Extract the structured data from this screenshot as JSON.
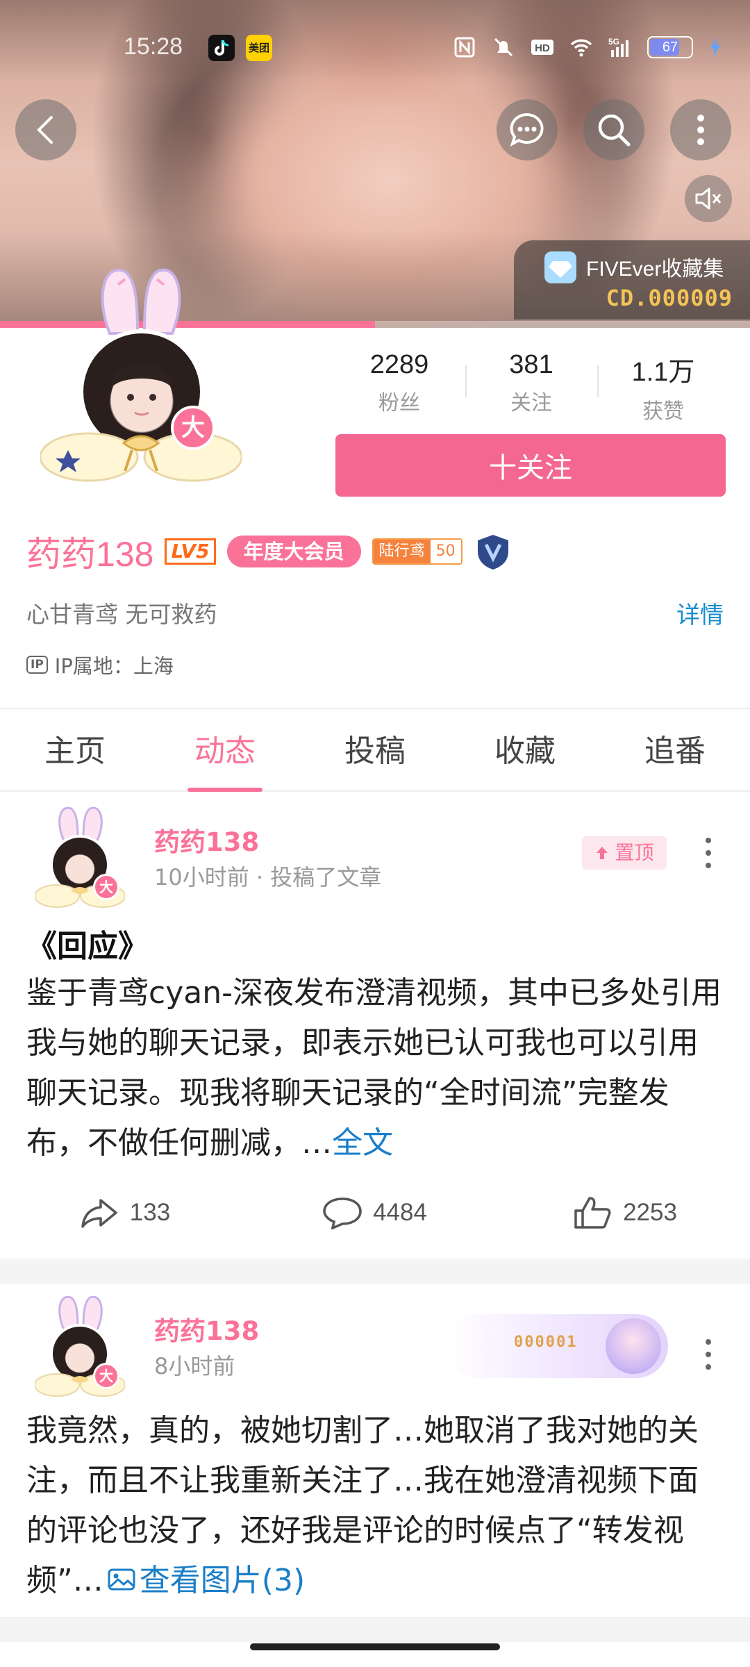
{
  "status_bar": {
    "time": "15:28",
    "apps": [
      "tiktok-icon",
      "meituan-icon"
    ],
    "meituan_label": "美团",
    "battery": "67",
    "network": "5G",
    "hd": "HD"
  },
  "header": {
    "collection": {
      "title": "FIVEver收藏集",
      "code": "CD.000009"
    },
    "video_progress": 0.5
  },
  "profile": {
    "avatar_badge": "大",
    "stats": [
      {
        "value": "2289",
        "label": "粉丝"
      },
      {
        "value": "381",
        "label": "关注"
      },
      {
        "value": "1.1万",
        "label": "获赞"
      }
    ],
    "follow_label": "十关注",
    "username": "药药138",
    "level": "LV5",
    "vip": "年度大会员",
    "medal": {
      "name": "陆行鸢",
      "level": "50"
    },
    "bio": "心甘青鸢 无可救药",
    "detail_link": "详情",
    "ip_icon": "IP",
    "ip_text": "IP属地：上海"
  },
  "tabs": [
    {
      "label": "主页",
      "active": false
    },
    {
      "label": "动态",
      "active": true
    },
    {
      "label": "投稿",
      "active": false
    },
    {
      "label": "收藏",
      "active": false
    },
    {
      "label": "追番",
      "active": false
    }
  ],
  "posts": [
    {
      "author": "药药138",
      "badge": "大",
      "meta": "10小时前 · 投稿了文章",
      "pinned_label": "置顶",
      "title": "《回应》",
      "body": "鉴于青鸢cyan-深夜发布澄清视频，其中已多处引用我与她的聊天记录，即表示她已认可我也可以引用聊天记录。现我将聊天记录的“全时间流”完整发布，不做任何删减，…",
      "more": "全文",
      "shares": "133",
      "comments": "4484",
      "likes": "2253"
    },
    {
      "author": "药药138",
      "badge": "大",
      "meta": "8小时前",
      "card_code": "000001",
      "body": "我竟然，真的，被她切割了…她取消了我对她的关注，而且不让我重新关注了…我在她澄清视频下面的评论也没了，还好我是评论的时候点了“转发视频”…",
      "images_label": "查看图片(3)"
    }
  ],
  "colors": {
    "accent": "#fb7299",
    "follow_button": "#f46790",
    "link": "#1a7ec8",
    "level": "#ff6a1a",
    "medal": "#f5823d",
    "collection_code": "#f4c356"
  }
}
